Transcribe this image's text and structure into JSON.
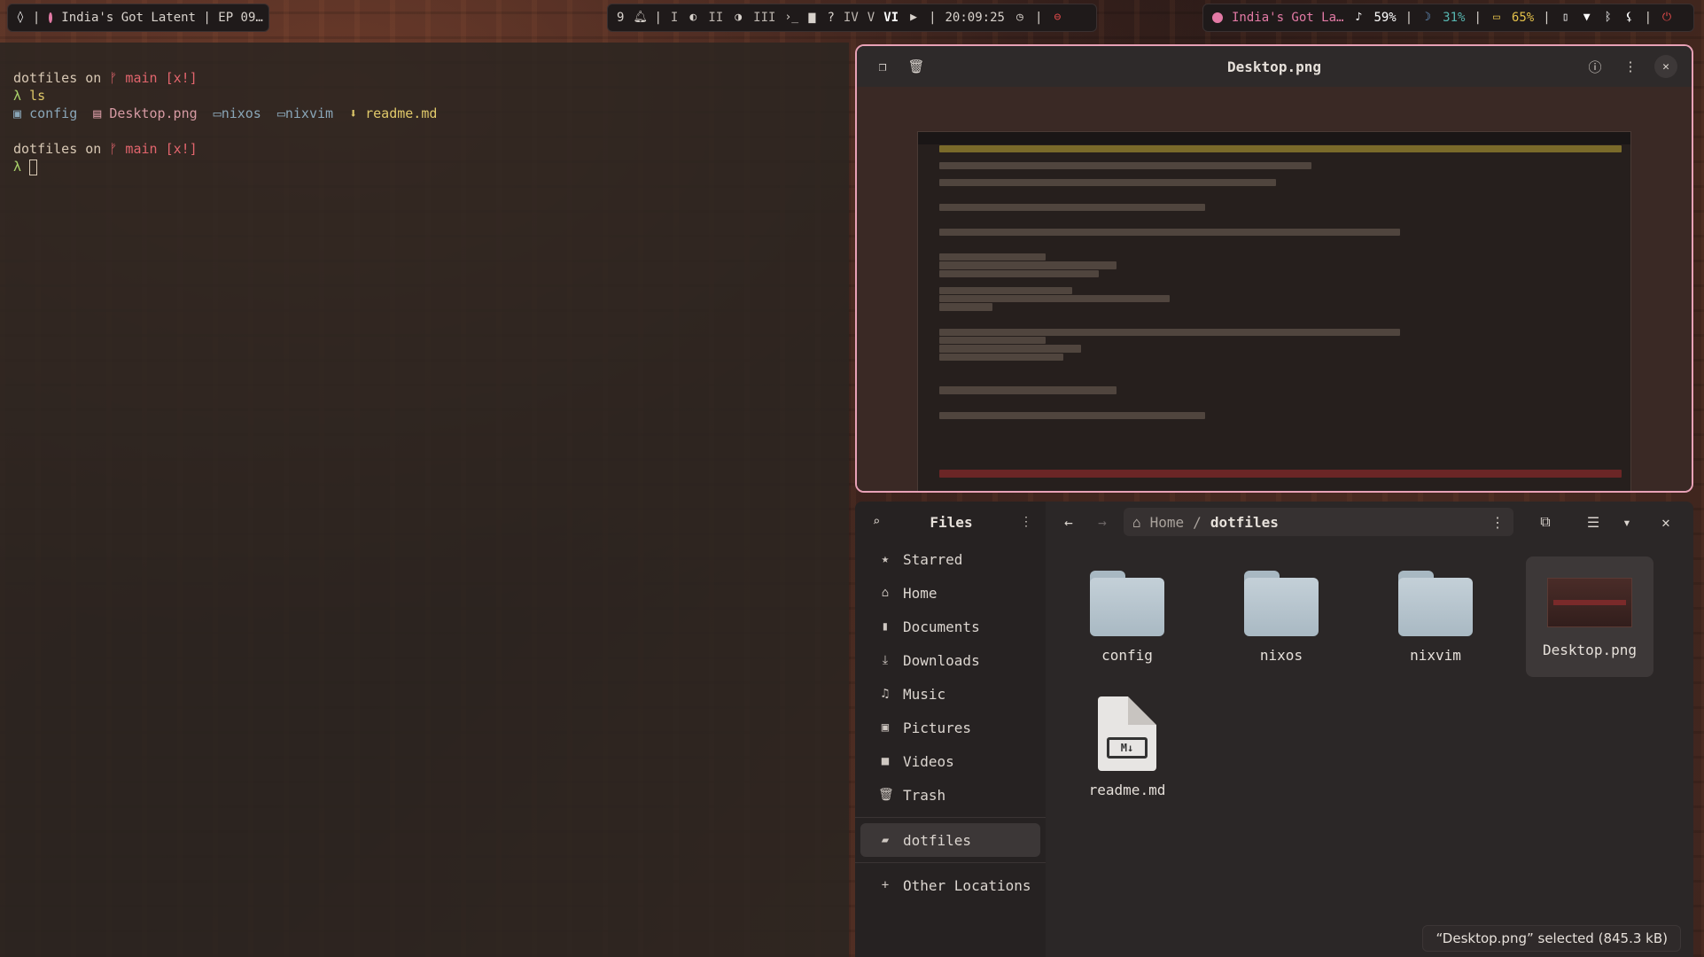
{
  "topbar": {
    "left": {
      "media_title": "India's Got Latent | EP 09…"
    },
    "center": {
      "notif_count": "9",
      "workspaces": [
        "I",
        "II",
        "III",
        "IV",
        "V",
        "VI"
      ],
      "ws_extra_1": "?",
      "clock": "20:09:25"
    },
    "right": {
      "media_title": "India's Got La…",
      "volume": "59%",
      "brightness": "31%",
      "battery": "65%"
    }
  },
  "terminal": {
    "prompt_user": "dotfiles",
    "prompt_on": "on",
    "branch": "main",
    "status": "[x!]",
    "prompt_char": "λ",
    "cmd": "ls",
    "ls": [
      "config",
      "Desktop.png",
      "nixos",
      "nixvim",
      "readme.md"
    ]
  },
  "viewer": {
    "title": "Desktop.png"
  },
  "files": {
    "sidebar_title": "Files",
    "places": [
      "Starred",
      "Home",
      "Documents",
      "Downloads",
      "Music",
      "Pictures",
      "Videos",
      "Trash"
    ],
    "bookmark": "dotfiles",
    "other_locations": "Other Locations",
    "path_home": "Home",
    "path_sep": "/",
    "path_current": "dotfiles",
    "items": [
      "config",
      "nixos",
      "nixvim",
      "Desktop.png",
      "readme.md"
    ],
    "md_badge": "M↓",
    "status": "“Desktop.png” selected (845.3 kB)"
  },
  "colors": {
    "accent_border": "#e8a1b6",
    "branch_red": "#e2656d",
    "prompt_green": "#a8d06a"
  },
  "icons": [
    "search-icon",
    "kebab-menu-icon",
    "back-arrow-icon",
    "forward-arrow-icon",
    "close-icon",
    "info-icon",
    "copy-icon",
    "trash-icon",
    "star-icon",
    "home-icon",
    "document-icon",
    "download-icon",
    "music-icon",
    "picture-icon",
    "video-icon",
    "folder-icon",
    "plus-icon"
  ]
}
